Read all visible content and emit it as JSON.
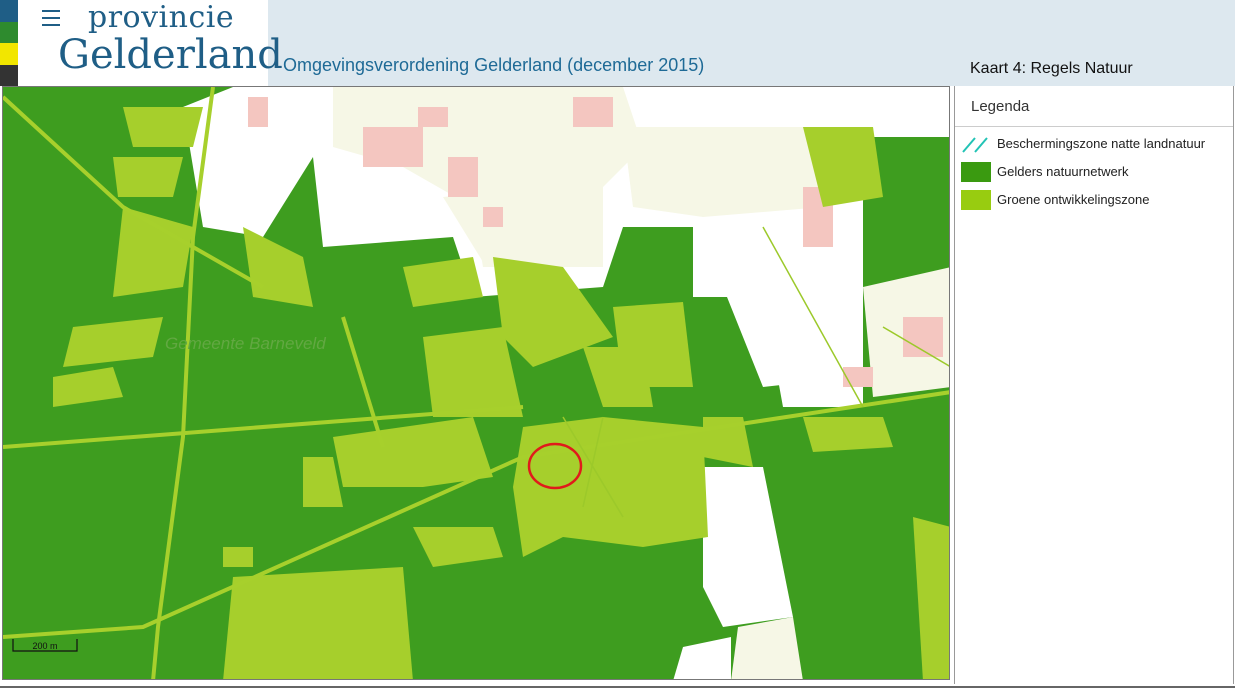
{
  "header": {
    "logo_top": "provincie",
    "logo_bottom": "Gelderland",
    "title": "Omgevingsverordening Gelderland (december 2015)",
    "map_ref": "Kaart 4:  Regels Natuur",
    "stripe_colors": [
      "#1f5e86",
      "#2e8b2e",
      "#f2e600",
      "#333333"
    ]
  },
  "map": {
    "place_label": "Gemeente  Barneveld",
    "scale_label": "200 m",
    "colors": {
      "natuurnetwerk": "#3d9c1d",
      "ontwikkelingszone": "#a9d12e",
      "background": "#ffffff",
      "agriculture": "#f6f7e6",
      "built": "#f6c4c0",
      "marker": "#e01b1b"
    }
  },
  "legend": {
    "title": "Legenda",
    "items": [
      {
        "label": "Beschermingszone natte landnatuur",
        "icon": "diagonal-hatch",
        "color": "#22c3b5"
      },
      {
        "label": "Gelders natuurnetwerk",
        "icon": "filled-square",
        "color": "#3a9a10"
      },
      {
        "label": "Groene ontwikkelingszone",
        "icon": "filled-square",
        "color": "#98cc10"
      }
    ]
  }
}
